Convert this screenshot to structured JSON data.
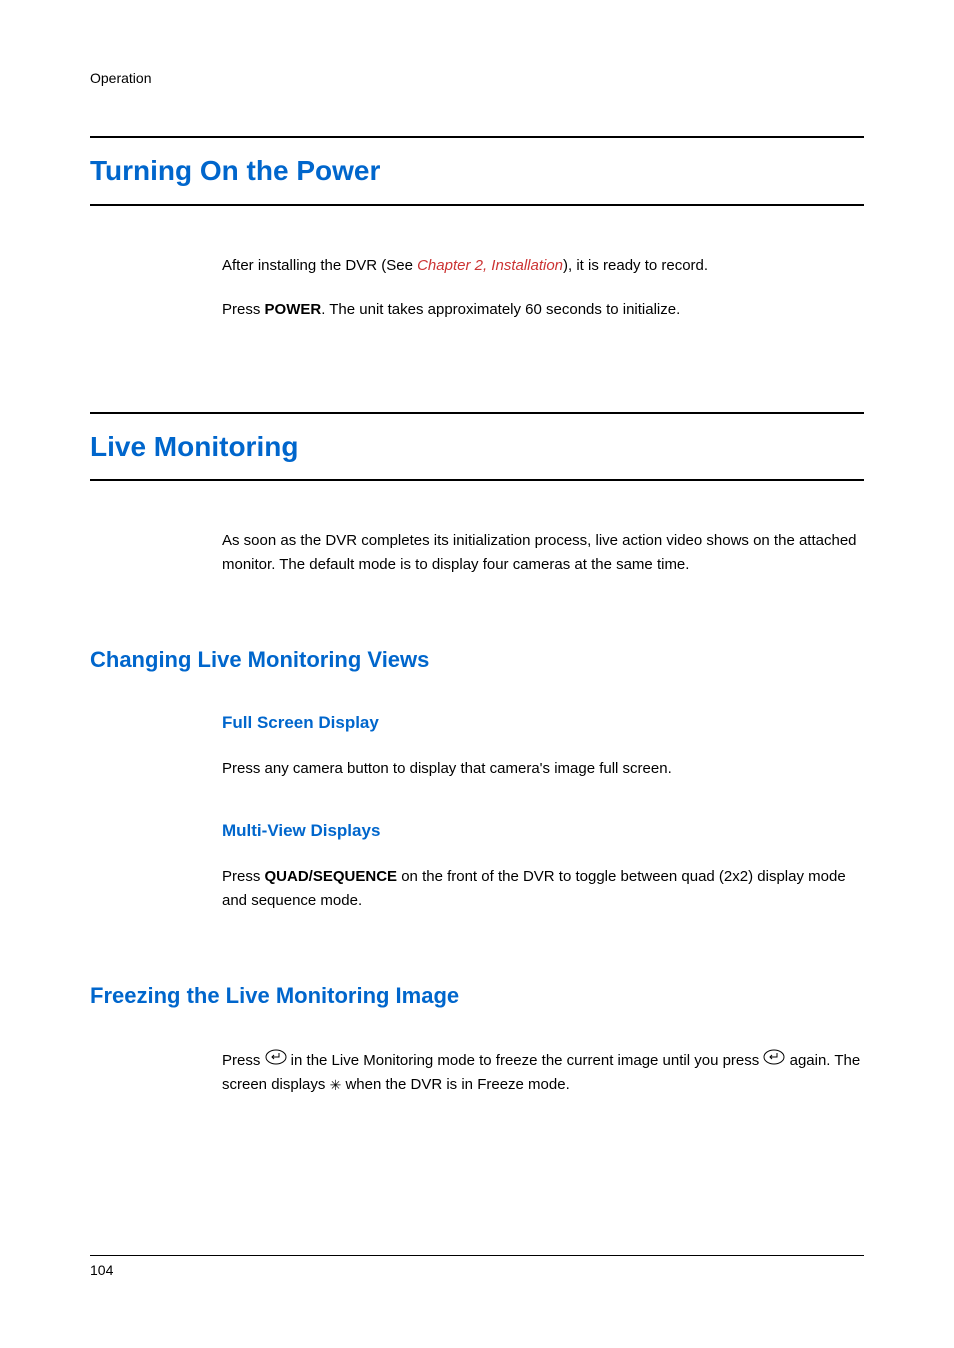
{
  "header": {
    "section_label": "Operation"
  },
  "section1": {
    "title": "Turning On the Power",
    "p1_pre": "After installing the DVR (See ",
    "p1_link": "Chapter 2, Installation",
    "p1_post": "), it is ready to record.",
    "p2_pre": "Press ",
    "p2_bold": "POWER",
    "p2_post": ". The unit takes approximately 60 seconds to initialize."
  },
  "section2": {
    "title": "Live Monitoring",
    "intro": "As soon as the DVR completes its initialization process, live action video shows on the attached monitor. The default mode is to display four cameras at the same time."
  },
  "subsection1": {
    "title": "Changing Live Monitoring Views",
    "sub_a": {
      "title": "Full Screen Display",
      "text": "Press any camera button to display that camera's image full screen."
    },
    "sub_b": {
      "title": "Multi-View Displays",
      "p_pre": "Press ",
      "p_bold": "QUAD/SEQUENCE",
      "p_post": " on the front of the DVR to toggle between quad (2x2) display mode and sequence mode."
    }
  },
  "subsection2": {
    "title": "Freezing the Live Monitoring Image",
    "p_pre": "Press ",
    "p_mid1": " in the Live Monitoring mode to freeze the current image until you press ",
    "p_mid2": " again. The screen displays ",
    "p_post": " when the DVR is in Freeze mode."
  },
  "footer": {
    "page_number": "104"
  }
}
